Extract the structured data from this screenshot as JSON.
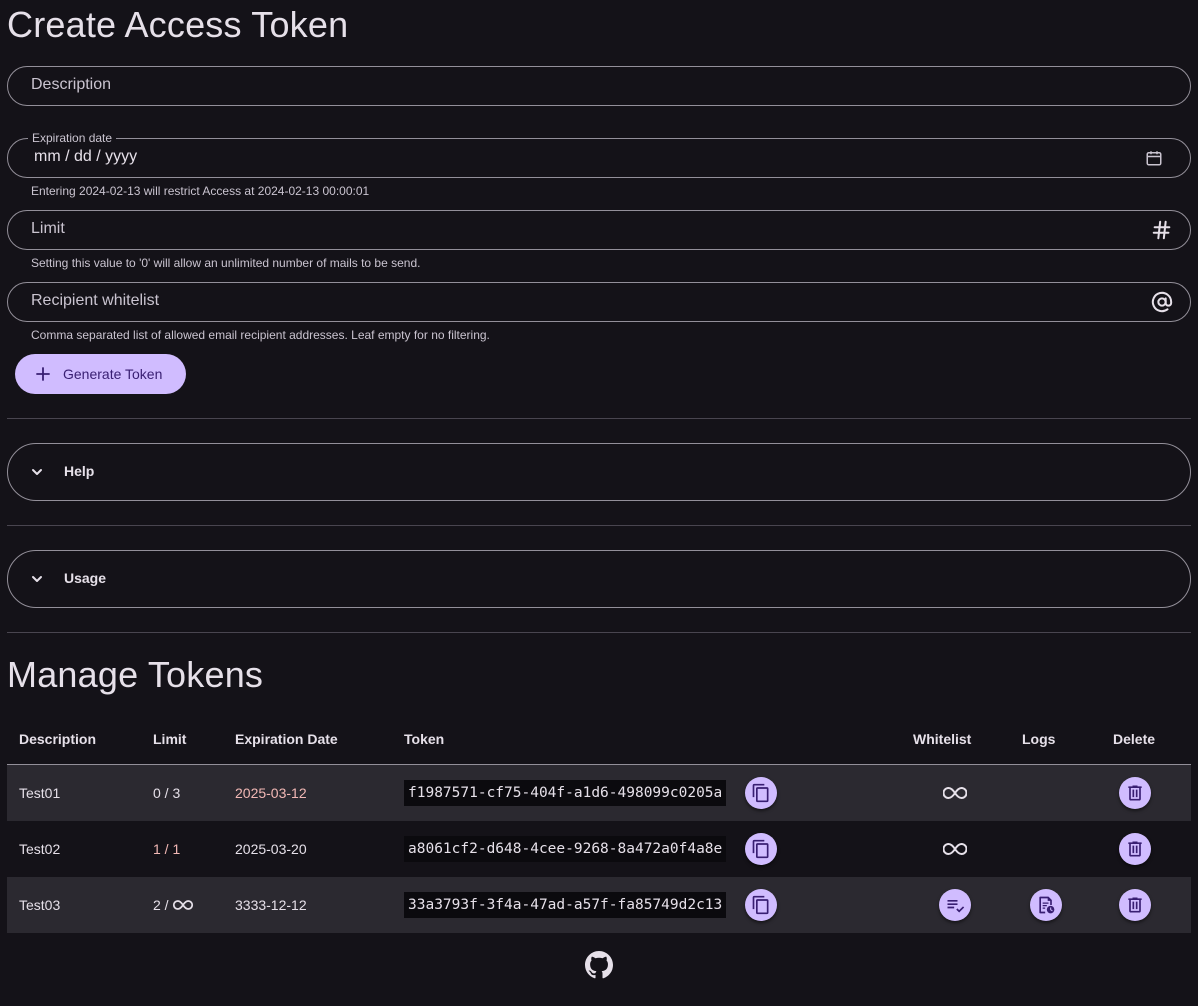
{
  "create": {
    "title": "Create Access Token",
    "description_label": "Description",
    "expiration": {
      "label": "Expiration date",
      "placeholder": "mm / dd / yyyy",
      "helper": "Entering 2024-02-13 will restrict Access at 2024-02-13 00:00:01"
    },
    "limit": {
      "label": "Limit",
      "helper": "Setting this value to '0' will allow an unlimited number of mails to be send."
    },
    "whitelist": {
      "label": "Recipient whitelist",
      "helper": "Comma separated list of allowed email recipient addresses. Leaf empty for no filtering."
    },
    "generate_button": "Generate Token"
  },
  "accordions": {
    "help": "Help",
    "usage": "Usage"
  },
  "manage": {
    "title": "Manage Tokens",
    "columns": {
      "description": "Description",
      "limit": "Limit",
      "expiration": "Expiration Date",
      "token": "Token",
      "whitelist": "Whitelist",
      "logs": "Logs",
      "delete": "Delete"
    },
    "rows": [
      {
        "description": "Test01",
        "limit": "0 / 3",
        "expiration": "2025-03-12",
        "token": "f1987571-cf75-404f-a1d6-498099c0205a",
        "whitelist_icon": "infinity-icon"
      },
      {
        "description": "Test02",
        "limit": "1 / 1",
        "expiration": "2025-03-20",
        "token": "a8061cf2-d648-4cee-9268-8a472a0f4a8e",
        "whitelist_icon": "infinity-icon"
      },
      {
        "description": "Test03",
        "limit": "2 /",
        "expiration": "3333-12-12",
        "token": "33a3793f-3f4a-47ad-a57f-fa85749d2c13",
        "whitelist_icon": "playlist-check-icon",
        "logs_icon": "log-icon"
      }
    ]
  },
  "colors": {
    "background": "#141218",
    "primary": "#d0bcff",
    "on_primary": "#381e72",
    "error_text": "#f2b8b5",
    "row_shade": "#2b2930"
  }
}
